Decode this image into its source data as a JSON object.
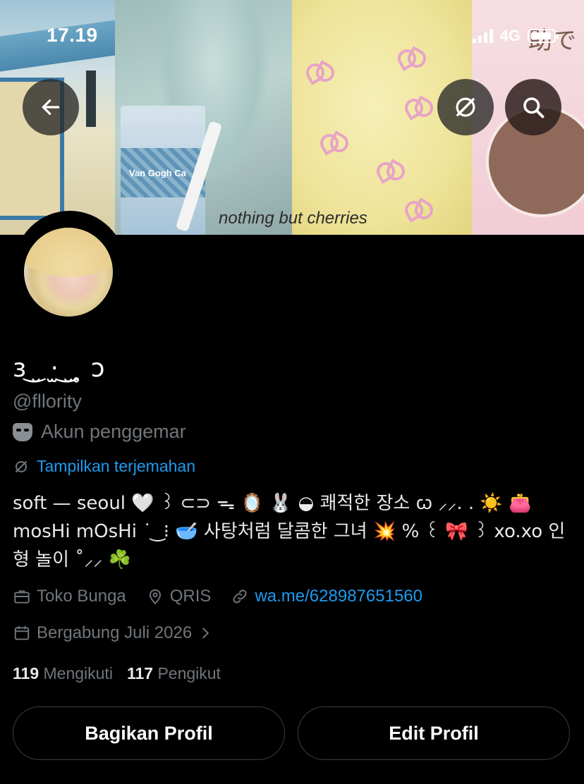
{
  "status": {
    "time": "17.19",
    "network": "4G"
  },
  "banner": {
    "caption": "nothing but cherries",
    "cup_text": "Van Gogh Ca",
    "panel4_text": "助で"
  },
  "profile": {
    "display_name": "ɜ ͜ ̮ ·̫ ͜ ̮ ̥ ɔ",
    "handle": "@fllority",
    "account_type": "Akun penggemar",
    "translate_label": "Tampilkan terjemahan",
    "bio": "s𝗈ft — se𝗈ul 🤍 ꒱ ⊂⊃ ᯓ 🪞 🐰 ◒ 쾌적한 장소 ꞷ ⸝⸝. . ☀️ 👛 mosHi mOsHi ˙ ͜ ⁝ 🥣 사탕처럼 달콤한 그녀 💥 % ꒰ 🎀 ꒱ xo.xo 인형 놀이 ˚⸝⸝ ☘️",
    "category": "Toko Bunga",
    "location": "QRIS",
    "link": "wa.me/628987651560",
    "joined": "Bergabung Juli 2026",
    "following_count": "119",
    "following_label": "Mengikuti",
    "followers_count": "117",
    "followers_label": "Pengikut"
  },
  "buttons": {
    "share": "Bagikan Profil",
    "edit": "Edit Profil"
  },
  "colors": {
    "link": "#1d9bf0",
    "muted": "#71767b",
    "background": "#000000"
  },
  "icons": [
    "back-arrow-icon",
    "translate-icon",
    "search-icon",
    "mask-icon",
    "briefcase-icon",
    "location-pin-icon",
    "link-icon",
    "calendar-icon",
    "chevron-right-icon"
  ]
}
